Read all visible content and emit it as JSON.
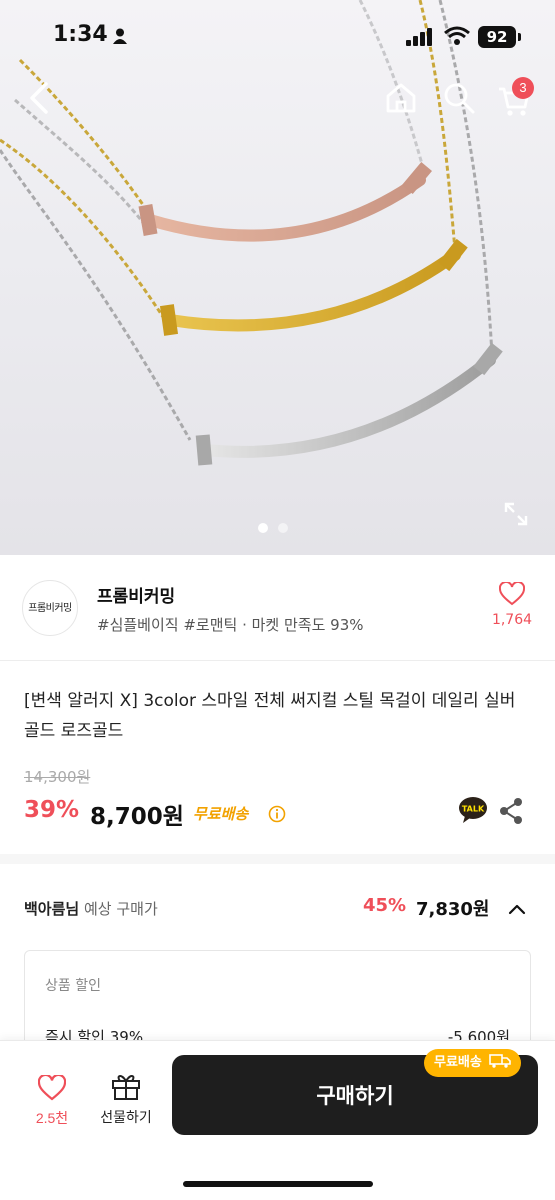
{
  "status_bar": {
    "time": "1:34",
    "battery": "92"
  },
  "cart": {
    "badge_count": "3"
  },
  "gallery": {
    "pages": 2,
    "current_page": 1
  },
  "shop": {
    "avatar_text": "프롬비커밍",
    "name": "프롬비커밍",
    "tags": "#심플베이직 #로맨틱 · 마켓 만족도 93%",
    "like_count": "1,764"
  },
  "product": {
    "title": "[변색 알러지 X] 3color 스마일 전체 써지컬 스틸 목걸이 데일리 실버 골드 로즈골드",
    "original_price": "14,300원",
    "discount": "39%",
    "price": "8,700원",
    "shipping": "무료배송"
  },
  "expected": {
    "user": "백아름님",
    "label": "예상 구매가",
    "discount": "45%",
    "price": "7,830원",
    "box_label": "상품 할인",
    "row_label": "즉시 할인 39%",
    "row_value": "-5,600원"
  },
  "bottom_bar": {
    "like_count": "2.5천",
    "gift_label": "선물하기",
    "buy_label": "구매하기",
    "free_ship_badge": "무료배송"
  },
  "colors": {
    "accent_red": "#ef4f59",
    "ship_yellow": "#f2a200",
    "badge_yellow": "#ffb400",
    "buy_bg": "#1e1e1e"
  }
}
